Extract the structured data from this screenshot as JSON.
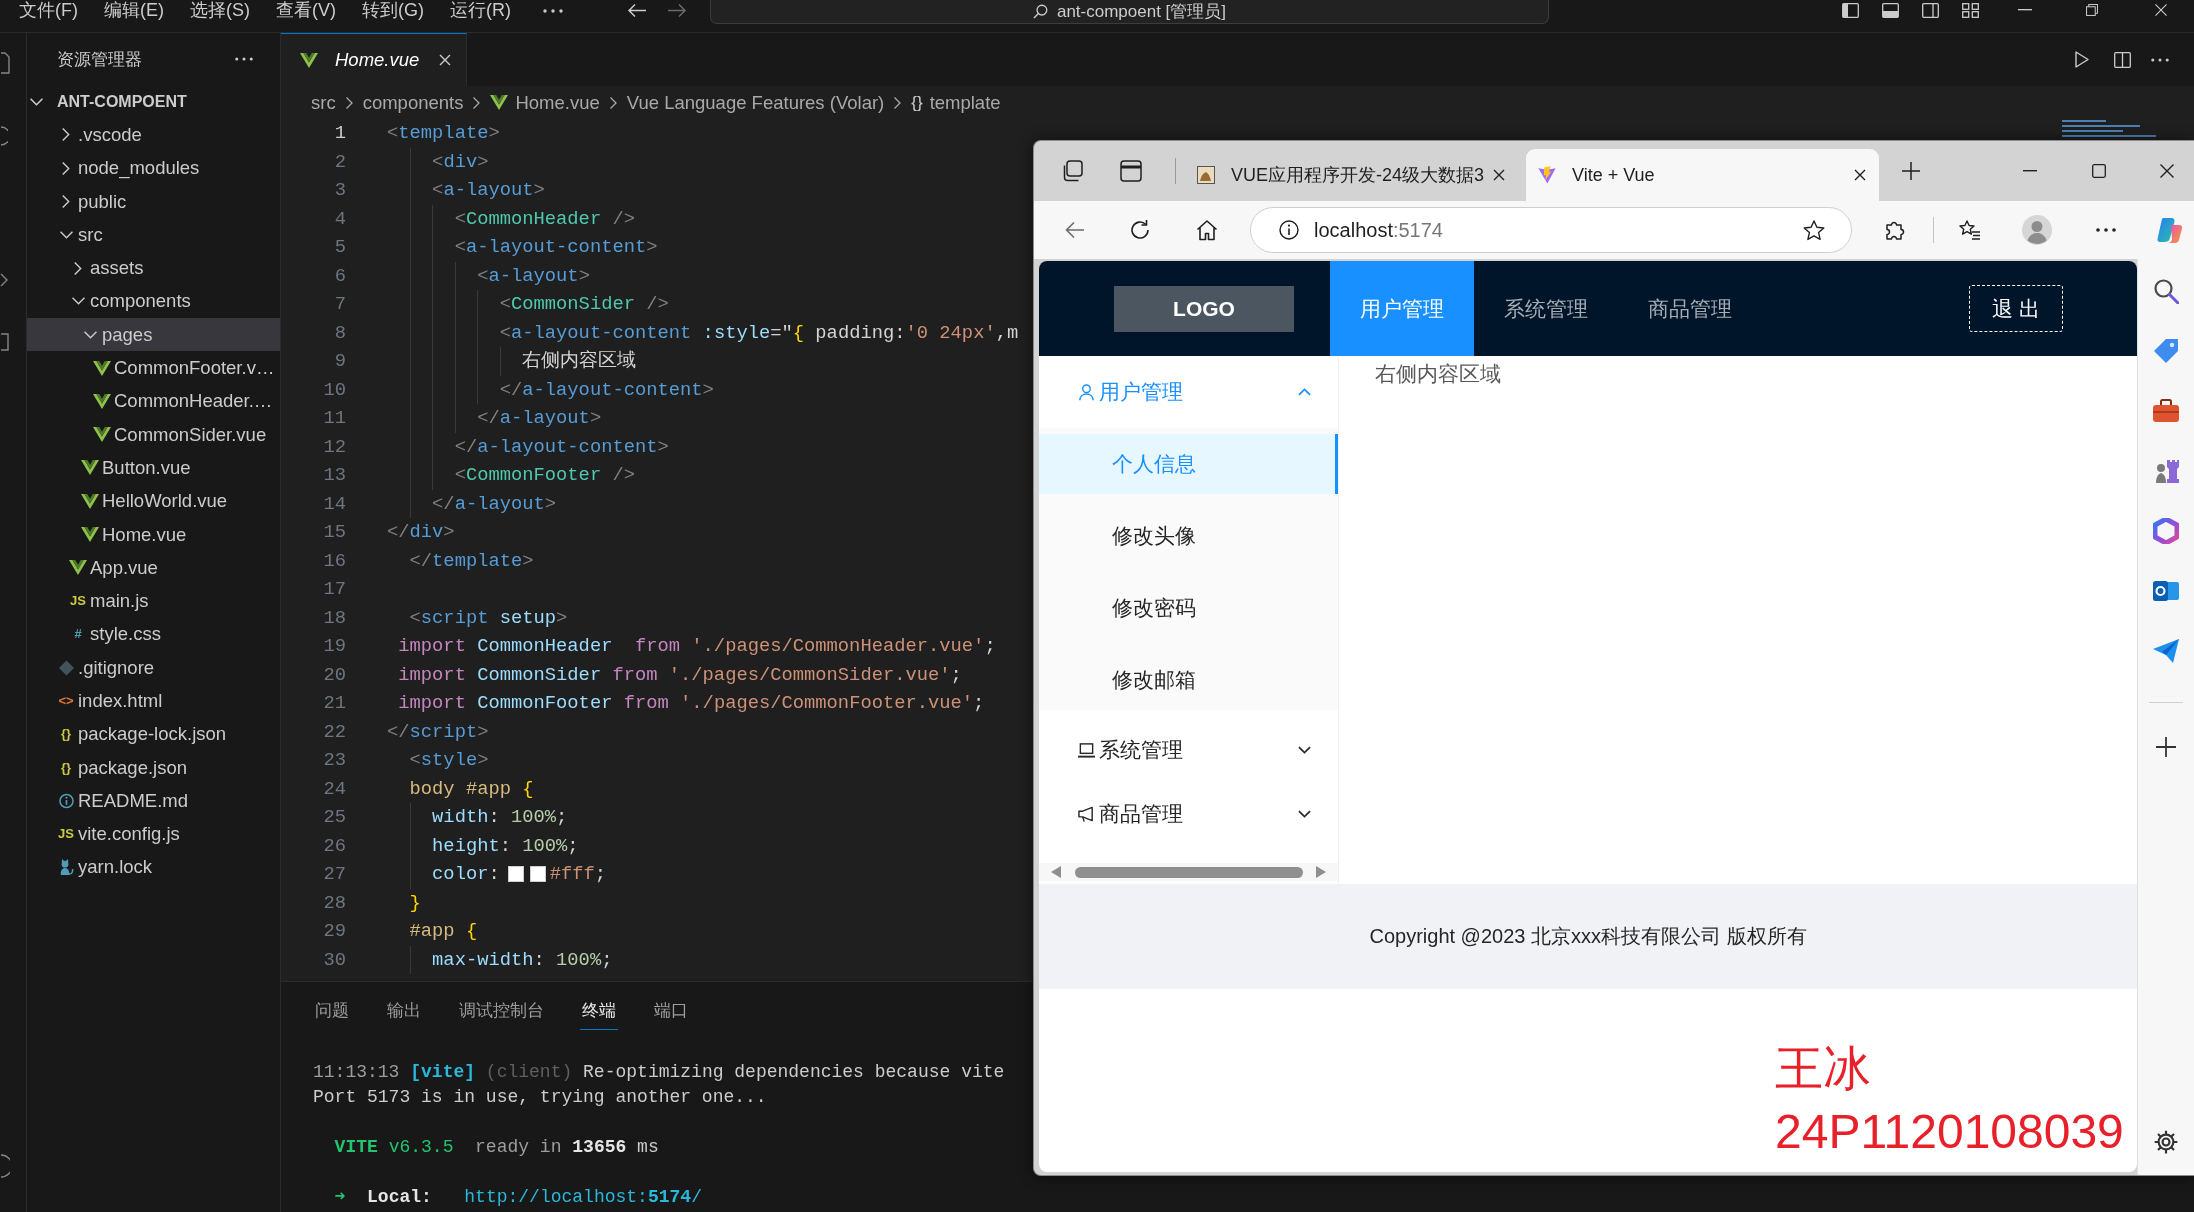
{
  "title_bar": {
    "menus": [
      "文件(F)",
      "编辑(E)",
      "选择(S)",
      "查看(V)",
      "转到(G)",
      "运行(R)"
    ],
    "back": {
      "disabled": false
    },
    "forward": {
      "disabled": true
    },
    "command_center": "ant-compoent [管理员]"
  },
  "explorer": {
    "title": "资源管理器",
    "section": {
      "label": "ANT-COMPOENT",
      "expanded": true
    },
    "tree": [
      {
        "label": ".vscode",
        "kind": "folder",
        "expanded": false,
        "selected": false
      },
      {
        "label": "node_modules",
        "kind": "folder",
        "expanded": false,
        "selected": false
      },
      {
        "label": "public",
        "kind": "folder",
        "expanded": false,
        "selected": false
      },
      {
        "label": "src",
        "kind": "folder",
        "expanded": true,
        "selected": false,
        "children": [
          {
            "label": "assets",
            "kind": "folder",
            "expanded": false,
            "selected": false
          },
          {
            "label": "components",
            "kind": "folder",
            "expanded": true,
            "selected": false,
            "children": [
              {
                "label": "pages",
                "kind": "folder",
                "expanded": true,
                "selected": true,
                "children": [
                  {
                    "label": "CommonFooter.v…",
                    "kind": "vue",
                    "selected": false
                  },
                  {
                    "label": "CommonHeader.…",
                    "kind": "vue",
                    "selected": false
                  },
                  {
                    "label": "CommonSider.vue",
                    "kind": "vue",
                    "selected": false
                  }
                ]
              },
              {
                "label": "Button.vue",
                "kind": "vue",
                "selected": false
              },
              {
                "label": "HelloWorld.vue",
                "kind": "vue",
                "selected": false
              },
              {
                "label": "Home.vue",
                "kind": "vue",
                "selected": false
              }
            ]
          },
          {
            "label": "App.vue",
            "kind": "vue",
            "selected": false
          },
          {
            "label": "main.js",
            "kind": "js",
            "icon": "JS",
            "selected": false
          },
          {
            "label": "style.css",
            "kind": "css",
            "icon": "#",
            "selected": false
          }
        ]
      },
      {
        "label": ".gitignore",
        "kind": "git",
        "selected": false
      },
      {
        "label": "index.html",
        "kind": "html",
        "icon": "<>",
        "selected": false
      },
      {
        "label": "package-lock.json",
        "kind": "json",
        "icon": "{}",
        "selected": false
      },
      {
        "label": "package.json",
        "kind": "json",
        "icon": "{}",
        "selected": false
      },
      {
        "label": "README.md",
        "kind": "info",
        "selected": false
      },
      {
        "label": "vite.config.js",
        "kind": "js",
        "icon": "JS",
        "selected": false
      },
      {
        "label": "yarn.lock",
        "kind": "yarn",
        "selected": false
      }
    ]
  },
  "editor": {
    "tabs": [
      {
        "label": "Home.vue",
        "kind": "vue",
        "preview": true,
        "selected": true
      }
    ],
    "breadcrumbs": [
      {
        "label": "src"
      },
      {
        "label": "components"
      },
      {
        "label": "Home.vue",
        "kind": "vue"
      },
      {
        "label": "Vue Language Features (Volar)"
      },
      {
        "label": "template",
        "icon": "{}"
      }
    ],
    "lines": [
      {
        "number": "1",
        "current": true,
        "tokens": [
          {
            "kind": "punct",
            "text": "<"
          },
          {
            "kind": "tag",
            "text": "template"
          },
          {
            "kind": "punct",
            "text": ">"
          }
        ]
      },
      {
        "number": "2",
        "current": false,
        "tokens": [
          {
            "kind": "punct",
            "text": "    <"
          },
          {
            "kind": "tag",
            "text": "div"
          },
          {
            "kind": "punct",
            "text": ">"
          }
        ]
      },
      {
        "number": "3",
        "current": false,
        "tokens": [
          {
            "kind": "punct",
            "text": "    <"
          },
          {
            "kind": "tag",
            "text": "a-layout"
          },
          {
            "kind": "punct",
            "text": ">"
          }
        ]
      },
      {
        "number": "4",
        "current": false,
        "tokens": [
          {
            "kind": "punct",
            "text": "      <"
          },
          {
            "kind": "component",
            "text": "CommonHeader"
          },
          {
            "kind": "punct",
            "text": " />"
          }
        ]
      },
      {
        "number": "5",
        "current": false,
        "tokens": [
          {
            "kind": "punct",
            "text": "      <"
          },
          {
            "kind": "tag",
            "text": "a-layout-content"
          },
          {
            "kind": "punct",
            "text": ">"
          }
        ]
      },
      {
        "number": "6",
        "current": false,
        "tokens": [
          {
            "kind": "punct",
            "text": "        <"
          },
          {
            "kind": "tag",
            "text": "a-layout"
          },
          {
            "kind": "punct",
            "text": ">"
          }
        ]
      },
      {
        "number": "7",
        "current": false,
        "tokens": [
          {
            "kind": "punct",
            "text": "          <"
          },
          {
            "kind": "component",
            "text": "CommonSider"
          },
          {
            "kind": "punct",
            "text": " />"
          }
        ]
      },
      {
        "number": "8",
        "current": false,
        "tokens": [
          {
            "kind": "punct",
            "text": "          <"
          },
          {
            "kind": "tag",
            "text": "a-layout-content"
          },
          {
            "kind": "attr",
            "text": " :style"
          },
          {
            "kind": "text",
            "text": "=\""
          },
          {
            "kind": "bracket",
            "text": "{"
          },
          {
            "kind": "text",
            "text": " padding:"
          },
          {
            "kind": "string",
            "text": "'0 24px'"
          },
          {
            "kind": "text",
            "text": ",m"
          }
        ]
      },
      {
        "number": "9",
        "current": false,
        "tokens": [
          {
            "kind": "text",
            "text": "            右侧内容区域"
          }
        ]
      },
      {
        "number": "10",
        "current": false,
        "tokens": [
          {
            "kind": "punct",
            "text": "          </"
          },
          {
            "kind": "tag",
            "text": "a-layout-content"
          },
          {
            "kind": "punct",
            "text": ">"
          }
        ]
      },
      {
        "number": "11",
        "current": false,
        "tokens": [
          {
            "kind": "punct",
            "text": "        </"
          },
          {
            "kind": "tag",
            "text": "a-layout"
          },
          {
            "kind": "punct",
            "text": ">"
          }
        ]
      },
      {
        "number": "12",
        "current": false,
        "tokens": [
          {
            "kind": "punct",
            "text": "      </"
          },
          {
            "kind": "tag",
            "text": "a-layout-content"
          },
          {
            "kind": "punct",
            "text": ">"
          }
        ]
      },
      {
        "number": "13",
        "current": false,
        "tokens": [
          {
            "kind": "punct",
            "text": "      <"
          },
          {
            "kind": "component",
            "text": "CommonFooter"
          },
          {
            "kind": "punct",
            "text": " />"
          }
        ]
      },
      {
        "number": "14",
        "current": false,
        "tokens": [
          {
            "kind": "punct",
            "text": "    </"
          },
          {
            "kind": "tag",
            "text": "a-layout"
          },
          {
            "kind": "punct",
            "text": ">"
          }
        ]
      },
      {
        "number": "15",
        "current": false,
        "tokens": [
          {
            "kind": "punct",
            "text": "</"
          },
          {
            "kind": "tag",
            "text": "div"
          },
          {
            "kind": "punct",
            "text": ">"
          }
        ]
      },
      {
        "number": "16",
        "current": false,
        "tokens": [
          {
            "kind": "punct",
            "text": "  </"
          },
          {
            "kind": "tag",
            "text": "template"
          },
          {
            "kind": "punct",
            "text": ">"
          }
        ]
      },
      {
        "number": "17",
        "current": false
      },
      {
        "number": "18",
        "current": false,
        "tokens": [
          {
            "kind": "punct",
            "text": "  <"
          },
          {
            "kind": "tag",
            "text": "script"
          },
          {
            "kind": "attr",
            "text": " setup"
          },
          {
            "kind": "punct",
            "text": ">"
          }
        ]
      },
      {
        "number": "19",
        "current": false,
        "tokens": [
          {
            "kind": "keyword",
            "text": " import"
          },
          {
            "kind": "ident",
            "text": " CommonHeader"
          },
          {
            "kind": "keyword",
            "text": "  from"
          },
          {
            "kind": "string",
            "text": " './pages/CommonHeader.vue'"
          },
          {
            "kind": "text",
            "text": ";"
          }
        ]
      },
      {
        "number": "20",
        "current": false,
        "tokens": [
          {
            "kind": "keyword",
            "text": " import"
          },
          {
            "kind": "ident",
            "text": " CommonSider"
          },
          {
            "kind": "keyword",
            "text": " from"
          },
          {
            "kind": "string",
            "text": " './pages/CommonSider.vue'"
          },
          {
            "kind": "text",
            "text": ";"
          }
        ]
      },
      {
        "number": "21",
        "current": false,
        "tokens": [
          {
            "kind": "keyword",
            "text": " import"
          },
          {
            "kind": "ident",
            "text": " CommonFooter"
          },
          {
            "kind": "keyword",
            "text": " from"
          },
          {
            "kind": "string",
            "text": " './pages/CommonFooter.vue'"
          },
          {
            "kind": "text",
            "text": ";"
          }
        ]
      },
      {
        "number": "22",
        "current": false,
        "tokens": [
          {
            "kind": "punct",
            "text": "</"
          },
          {
            "kind": "tag",
            "text": "script"
          },
          {
            "kind": "punct",
            "text": ">"
          }
        ]
      },
      {
        "number": "23",
        "current": false,
        "tokens": [
          {
            "kind": "punct",
            "text": "  <"
          },
          {
            "kind": "tag",
            "text": "style"
          },
          {
            "kind": "punct",
            "text": ">"
          }
        ]
      },
      {
        "number": "24",
        "current": false,
        "tokens": [
          {
            "kind": "selector",
            "text": "  body #app"
          },
          {
            "kind": "bracket",
            "text": " {"
          }
        ]
      },
      {
        "number": "25",
        "current": false,
        "tokens": [
          {
            "kind": "property",
            "text": "    width"
          },
          {
            "kind": "text",
            "text": ": "
          },
          {
            "kind": "number",
            "text": "100%"
          },
          {
            "kind": "text",
            "text": ";"
          }
        ]
      },
      {
        "number": "26",
        "current": false,
        "tokens": [
          {
            "kind": "property",
            "text": "    height"
          },
          {
            "kind": "text",
            "text": ": "
          },
          {
            "kind": "number",
            "text": "100%"
          },
          {
            "kind": "text",
            "text": ";"
          }
        ]
      },
      {
        "number": "27",
        "current": false,
        "tokens": [
          {
            "kind": "property",
            "text": "    color"
          },
          {
            "kind": "text",
            "text": ":"
          },
          {
            "kind": "swatch",
            "color": "#ffffff"
          },
          {
            "kind": "swatch",
            "color": "#ffffff"
          },
          {
            "kind": "string",
            "text": "#fff"
          },
          {
            "kind": "text",
            "text": ";"
          }
        ]
      },
      {
        "number": "28",
        "current": false,
        "tokens": [
          {
            "kind": "bracket",
            "text": "  }"
          }
        ]
      },
      {
        "number": "29",
        "current": false,
        "tokens": [
          {
            "kind": "selector",
            "text": "  #app"
          },
          {
            "kind": "bracket",
            "text": " {"
          }
        ]
      },
      {
        "number": "30",
        "current": false,
        "tokens": [
          {
            "kind": "property",
            "text": "    max-width"
          },
          {
            "kind": "text",
            "text": ": "
          },
          {
            "kind": "number",
            "text": "100%"
          },
          {
            "kind": "text",
            "text": ";"
          }
        ]
      }
    ]
  },
  "panel": {
    "tabs": [
      {
        "label": "问题",
        "selected": false
      },
      {
        "label": "输出",
        "selected": false
      },
      {
        "label": "调试控制台",
        "selected": false
      },
      {
        "label": "终端",
        "selected": true
      },
      {
        "label": "端口",
        "selected": false
      }
    ],
    "terminal": [
      {
        "lines": [
          {
            "tokens": [
              {
                "kind": "time",
                "text": "11:13:13"
              },
              {
                "kind": "tag",
                "text": " [vite]"
              },
              {
                "kind": "client",
                "text": " (client)"
              },
              {
                "kind": "text",
                "text": " Re-optimizing dependencies because vite"
              }
            ]
          },
          {
            "tokens": [
              {
                "kind": "text",
                "text": "Port 5173 is in use, trying another one..."
              }
            ]
          }
        ]
      },
      {
        "lines": [
          {
            "tokens": [
              {
                "kind": "brand",
                "text": "  VITE"
              },
              {
                "kind": "version",
                "text": " v6.3.5"
              },
              {
                "kind": "muted",
                "text": "  ready in"
              },
              {
                "kind": "strong",
                "text": " 13656"
              },
              {
                "kind": "text",
                "text": " ms"
              }
            ]
          }
        ]
      },
      {
        "lines": [
          {
            "tokens": [
              {
                "kind": "arrow",
                "text": "  ➜"
              },
              {
                "kind": "label",
                "text": "  Local:"
              },
              {
                "kind": "url",
                "text": "   http://localhost:"
              },
              {
                "kind": "port",
                "text": "5174"
              },
              {
                "kind": "url",
                "text": "/"
              }
            ]
          }
        ]
      }
    ]
  },
  "browser": {
    "tabs": [
      {
        "title": "VUE应用程序开发-24级大数据3",
        "kind": "thumbnail",
        "selected": false
      },
      {
        "title": "Vite + Vue",
        "kind": "vite",
        "selected": true
      }
    ],
    "toolbar": {
      "back": {
        "disabled": true
      },
      "address": {
        "host": "localhost",
        "port": ":5174"
      }
    },
    "page": {
      "header": {
        "logo": "LOGO",
        "menu": [
          {
            "label": "用户管理",
            "selected": true
          },
          {
            "label": "系统管理",
            "selected": false
          },
          {
            "label": "商品管理",
            "selected": false
          }
        ],
        "logout": "退 出"
      },
      "sider": [
        {
          "label": "用户管理",
          "kind": "user",
          "expanded": true,
          "children": [
            {
              "label": "个人信息",
              "selected": true
            },
            {
              "label": "修改头像",
              "selected": false
            },
            {
              "label": "修改密码",
              "selected": false
            },
            {
              "label": "修改邮箱",
              "selected": false
            }
          ]
        },
        {
          "label": "系统管理",
          "kind": "laptop",
          "expanded": false
        },
        {
          "label": "商品管理",
          "kind": "notification",
          "expanded": false
        }
      ],
      "content": "右侧内容区域",
      "footer": "Copyright @2023 北京xxx科技有限公司 版权所有"
    }
  },
  "annotation": {
    "lines": [
      "王冰",
      "24P1120108039"
    ]
  }
}
